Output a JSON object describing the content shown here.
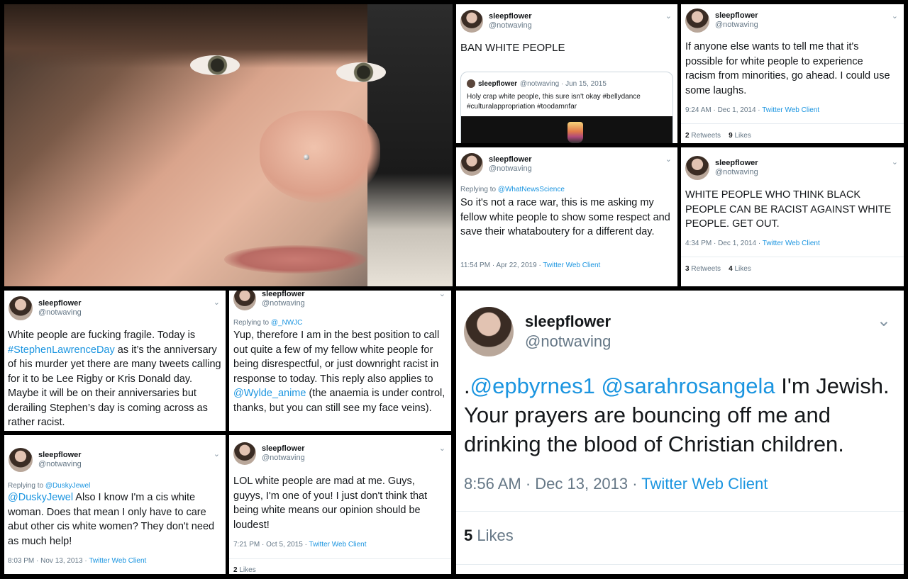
{
  "colors": {
    "link": "#1b95e0",
    "muted": "#657786",
    "text": "#14171a"
  },
  "icons": {
    "chevron": "chevron-down-icon"
  },
  "tweets": {
    "t1": {
      "name": "sleepflower",
      "handle": "@notwaving",
      "text": "BAN WHITE PEOPLE",
      "quote": {
        "name": "sleepflower",
        "handle": "@notwaving · Jun 15, 2015",
        "text": "Holy crap white people, this sure isn't okay #bellydance #culturalappropriation #toodamnfar"
      }
    },
    "t2": {
      "name": "sleepflower",
      "handle": "@notwaving",
      "text": "If anyone else wants to tell me that it's possible for white people to experience racism from minorities, go ahead. I could use some laughs.",
      "time": "9:24 AM · Dec 1, 2014 · ",
      "source": "Twitter Web Client",
      "retweets_count": "2",
      "retweets_label": "Retweets",
      "likes_count": "9",
      "likes_label": "Likes"
    },
    "t3": {
      "name": "sleepflower",
      "handle": "@notwaving",
      "reply_prefix": "Replying to ",
      "reply_to": "@WhatNewsScience",
      "text": "So it's not a race war, this is me asking my fellow white people to show some respect and save their whataboutery for a different day.",
      "time": "11:54 PM · Apr 22, 2019 · ",
      "source": "Twitter Web Client"
    },
    "t4": {
      "name": "sleepflower",
      "handle": "@notwaving",
      "text": "WHITE PEOPLE WHO THINK BLACK PEOPLE CAN BE RACIST AGAINST WHITE PEOPLE. GET OUT.",
      "time": "4:34 PM · Dec 1, 2014 · ",
      "source": "Twitter Web Client",
      "retweets_count": "3",
      "retweets_label": "Retweets",
      "likes_count": "4",
      "likes_label": "Likes"
    },
    "t5": {
      "name": "sleepflower",
      "handle": "@notwaving",
      "text_a": "White people are fucking fragile. Today is ",
      "hashtag": "#StephenLawrenceDay",
      "text_b": " as it’s the anniversary of his murder yet there are many tweets calling for it to be Lee Rigby or Kris Donald day. Maybe it will be on their anniversaries but derailing Stephen’s day is coming across as rather racist."
    },
    "t6": {
      "name": "sleepflower",
      "handle": "@notwaving",
      "reply_prefix": "Replying to ",
      "reply_to": "@_NWJC",
      "text_a": "Yup, therefore I am in the best position to call out quite a few of my fellow white people for being disrespectful, or just downright racist in response to today. This reply also applies to ",
      "mention": "@Wylde_anime",
      "text_b": " (the anaemia is under control, thanks, but you can still see my face veins)."
    },
    "t7": {
      "name": "sleepflower",
      "handle": "@notwaving",
      "reply_prefix": "Replying to ",
      "reply_to": "@DuskyJewel",
      "mention": "@DuskyJewel",
      "text": " Also I know I'm a cis white woman. Does that mean I only have to care abut other cis white women? They don't need as much help!",
      "time": "8:03 PM · Nov 13, 2013 · ",
      "source": "Twitter Web Client"
    },
    "t8": {
      "name": "sleepflower",
      "handle": "@notwaving",
      "text": "LOL white people are mad at me. Guys, guyys, I'm one of you! I just don't think that being white means our opinion should be loudest!",
      "time": "7:21 PM · Oct 5, 2015 · ",
      "source": "Twitter Web Client",
      "likes_count": "2",
      "likes_label": "Likes"
    },
    "t9": {
      "name": "sleepflower",
      "handle": "@notwaving",
      "prefix": ".",
      "mention1": "@epbyrnes1",
      "mention2": "@sarahrosangela",
      "text": " I'm Jewish. Your prayers are bouncing off me and drinking the blood of Christian children.",
      "time": "8:56 AM · Dec 13, 2013 · ",
      "source": "Twitter Web Client",
      "likes_count": "5",
      "likes_label": "Likes"
    }
  }
}
